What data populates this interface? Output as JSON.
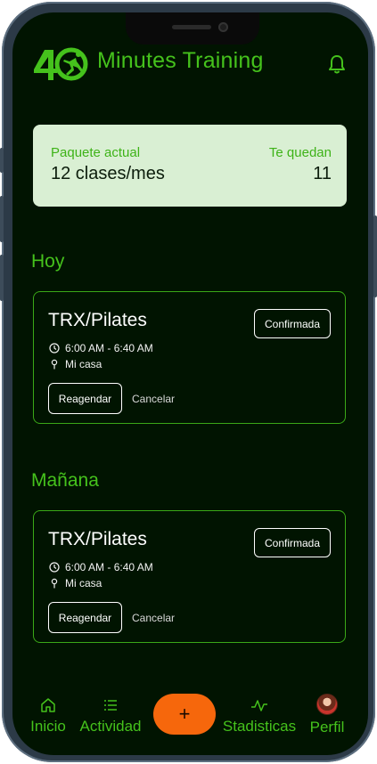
{
  "app": {
    "title": "Minutes Training",
    "logo_number": "40"
  },
  "plan": {
    "label": "Paquete actual",
    "value": "12 clases/mes",
    "remaining_label": "Te quedan",
    "remaining_value": "11"
  },
  "sections": [
    {
      "title": "Hoy",
      "class": {
        "name": "TRX/Pilates",
        "status": "Confirmada",
        "time": "6:00 AM - 6:40 AM",
        "place": "Mi casa",
        "reschedule_label": "Reagendar",
        "cancel_label": "Cancelar"
      }
    },
    {
      "title": "Mañana",
      "class": {
        "name": "TRX/Pilates",
        "status": "Confirmada",
        "time": "6:00 AM - 6:40 AM",
        "place": "Mi casa",
        "reschedule_label": "Reagendar",
        "cancel_label": "Cancelar"
      }
    }
  ],
  "nav": {
    "home": "Inicio",
    "activity": "Actividad",
    "add": "+",
    "stats": "Stadisticas",
    "profile": "Perfil"
  },
  "colors": {
    "background": "#011401",
    "accent_green": "#45c21c",
    "card_bg": "#d9efd3",
    "fab_orange": "#f6670c"
  },
  "icons": {
    "notification": "bell-icon",
    "home": "home-icon",
    "activity": "list-icon",
    "stats": "activity-chart-icon",
    "time": "clock-icon",
    "place": "location-pin-icon"
  }
}
